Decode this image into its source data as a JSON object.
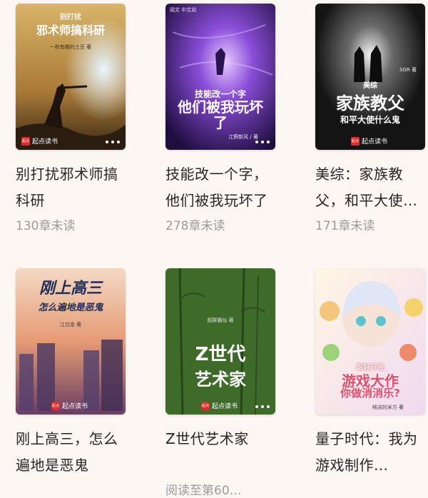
{
  "brand_name": "起点读书",
  "brand_logo": "起点",
  "books": [
    {
      "title": "别打扰邪术师搞科研",
      "progress": "130章未读",
      "cover_top": "别打扰",
      "cover_main": "邪术师搞科研",
      "cover_author": "一枚有趣的土豆 著"
    },
    {
      "title": "技能改一个字，他们被我玩坏了",
      "progress": "278章未读",
      "cover_badge": "阅文 中文站",
      "cover_top": "技能改一个字",
      "cover_main": "他们被我玩坏了",
      "cover_author": "江野新风 / 著"
    },
    {
      "title": "美综：家族教父，和平大使什么鬼",
      "progress": "171章未读",
      "cover_top": "美综",
      "cover_main": "家族教父",
      "cover_sub": "和平大使什么鬼",
      "cover_author": "SGR 著"
    },
    {
      "title": "刚上高三，怎么遍地是恶鬼",
      "progress": "",
      "cover_main": "刚上高三",
      "cover_sub": "怎么遍地是恶鬼",
      "cover_author": "江白金 著"
    },
    {
      "title": "Z世代艺术家",
      "progress": "阅读至第60…",
      "cover_author": "超群霸仙 著",
      "cover_main": "Z世代",
      "cover_sub": "艺术家"
    },
    {
      "title": "量子时代：我为游戏制作…",
      "progress": "",
      "cover_top": "说好开发",
      "cover_main": "游戏大作",
      "cover_sub": "你做消消乐?",
      "cover_author": "纯洁的米方 著"
    }
  ]
}
